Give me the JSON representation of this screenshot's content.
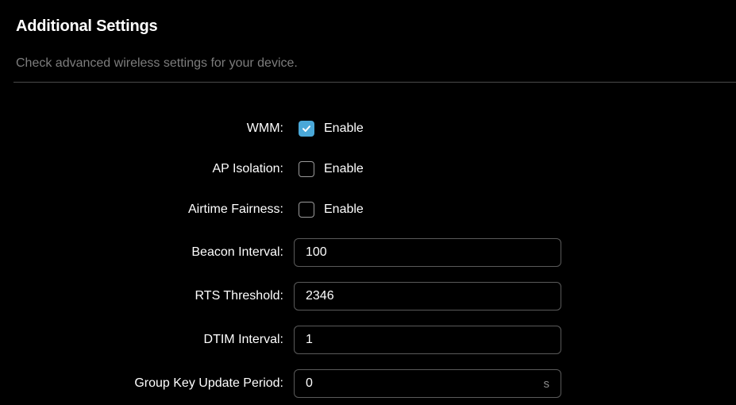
{
  "section": {
    "title": "Additional Settings",
    "description": "Check advanced wireless settings for your device."
  },
  "fields": {
    "wmm": {
      "label": "WMM:",
      "option": "Enable",
      "checked": true
    },
    "ap_isolation": {
      "label": "AP Isolation:",
      "option": "Enable",
      "checked": false
    },
    "airtime_fairness": {
      "label": "Airtime Fairness:",
      "option": "Enable",
      "checked": false
    },
    "beacon_interval": {
      "label": "Beacon Interval:",
      "value": "100"
    },
    "rts_threshold": {
      "label": "RTS Threshold:",
      "value": "2346"
    },
    "dtim_interval": {
      "label": "DTIM Interval:",
      "value": "1"
    },
    "group_key_update_period": {
      "label": "Group Key Update Period:",
      "value": "0",
      "unit": "s"
    }
  },
  "colors": {
    "background": "#000000",
    "accent": "#4aa8d8",
    "muted_text": "#7d7d7d",
    "field_border": "#5a5a5a"
  },
  "icons": {
    "checked_box": "check-icon"
  }
}
